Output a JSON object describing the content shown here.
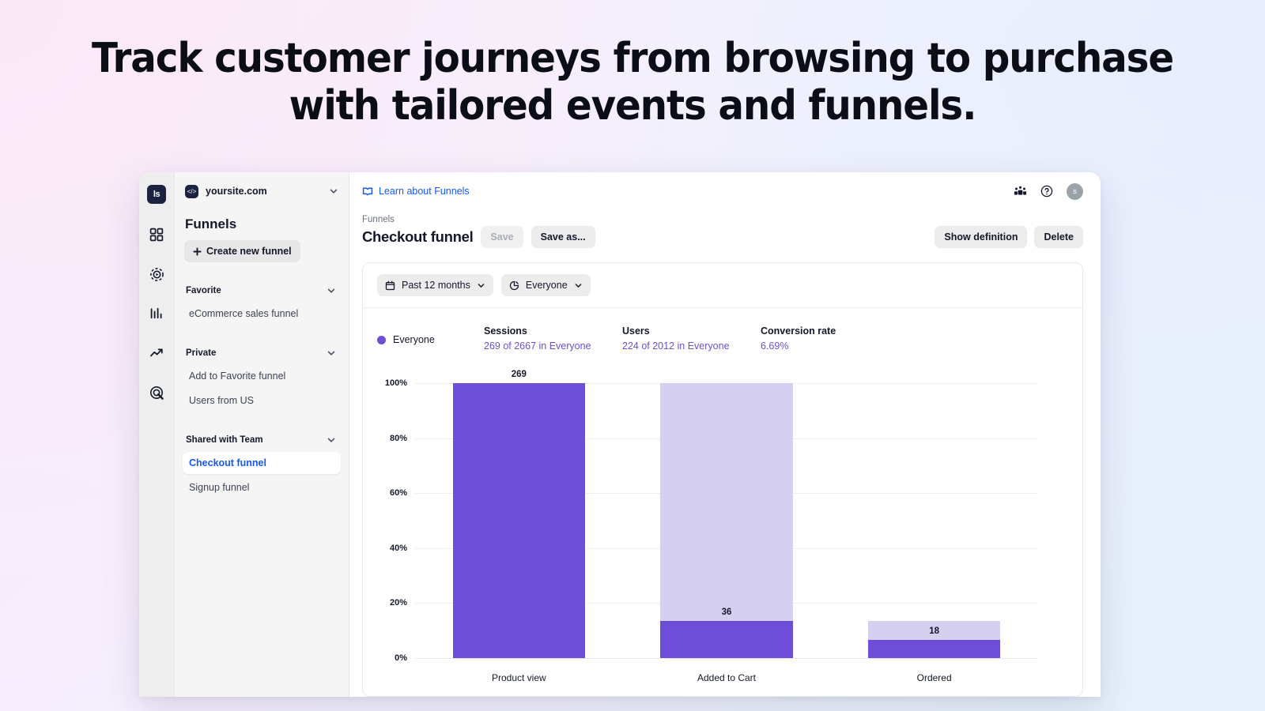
{
  "hero": {
    "line1": "Track customer journeys from browsing to purchase",
    "line2": "with tailored events and funnels."
  },
  "colors": {
    "accent_purple": "#6d4ed6",
    "ghost_purple": "#d5cff0",
    "link_blue": "#1557ff",
    "text_dark": "#14182a"
  },
  "rail": {
    "logo": "ls",
    "icons": [
      {
        "name": "dashboard-icon"
      },
      {
        "name": "session-replay-icon"
      },
      {
        "name": "bar-chart-icon"
      },
      {
        "name": "trend-up-icon"
      },
      {
        "name": "click-target-icon"
      }
    ]
  },
  "sidebar": {
    "site_name": "yoursite.com",
    "site_icon": "code-icon",
    "title": "Funnels",
    "create_button": "Create new funnel",
    "groups": [
      {
        "label": "Favorite",
        "items": [
          {
            "label": "eCommerce sales funnel",
            "active": false
          }
        ]
      },
      {
        "label": "Private",
        "items": [
          {
            "label": "Add to Favorite funnel",
            "active": false
          },
          {
            "label": "Users from US",
            "active": false
          }
        ]
      },
      {
        "label": "Shared with Team",
        "items": [
          {
            "label": "Checkout funnel",
            "active": true
          },
          {
            "label": "Signup funnel",
            "active": false
          }
        ]
      }
    ]
  },
  "topbar": {
    "learn_link": "Learn about Funnels",
    "avatar_initial": "s"
  },
  "header": {
    "breadcrumb": "Funnels",
    "title": "Checkout funnel",
    "save_label": "Save",
    "save_as_label": "Save as...",
    "show_definition_label": "Show definition",
    "delete_label": "Delete"
  },
  "filters": {
    "date_range": "Past 12 months",
    "segment": "Everyone"
  },
  "stats": {
    "legend_label": "Everyone",
    "items": [
      {
        "label": "Sessions",
        "value": "269 of 2667 in Everyone"
      },
      {
        "label": "Users",
        "value": "224 of 2012 in Everyone"
      },
      {
        "label": "Conversion rate",
        "value": "6.69%"
      }
    ]
  },
  "chart_data": {
    "type": "bar",
    "title": "",
    "xlabel": "",
    "ylabel": "",
    "categories": [
      "Product view",
      "Added to Cart",
      "Ordered"
    ],
    "values": [
      269,
      36,
      18
    ],
    "percent_of_first": [
      100,
      13.4,
      6.7
    ],
    "ghost_percent": [
      100,
      100,
      13.4
    ],
    "ytick_labels": [
      "100%",
      "80%",
      "60%",
      "40%",
      "20%",
      "0%"
    ],
    "ytick_values": [
      100,
      80,
      60,
      40,
      20,
      0
    ],
    "ylim": [
      0,
      100
    ],
    "grid": true,
    "legend": "Everyone",
    "series": [
      {
        "name": "Everyone",
        "values": [
          269,
          36,
          18
        ]
      }
    ]
  }
}
